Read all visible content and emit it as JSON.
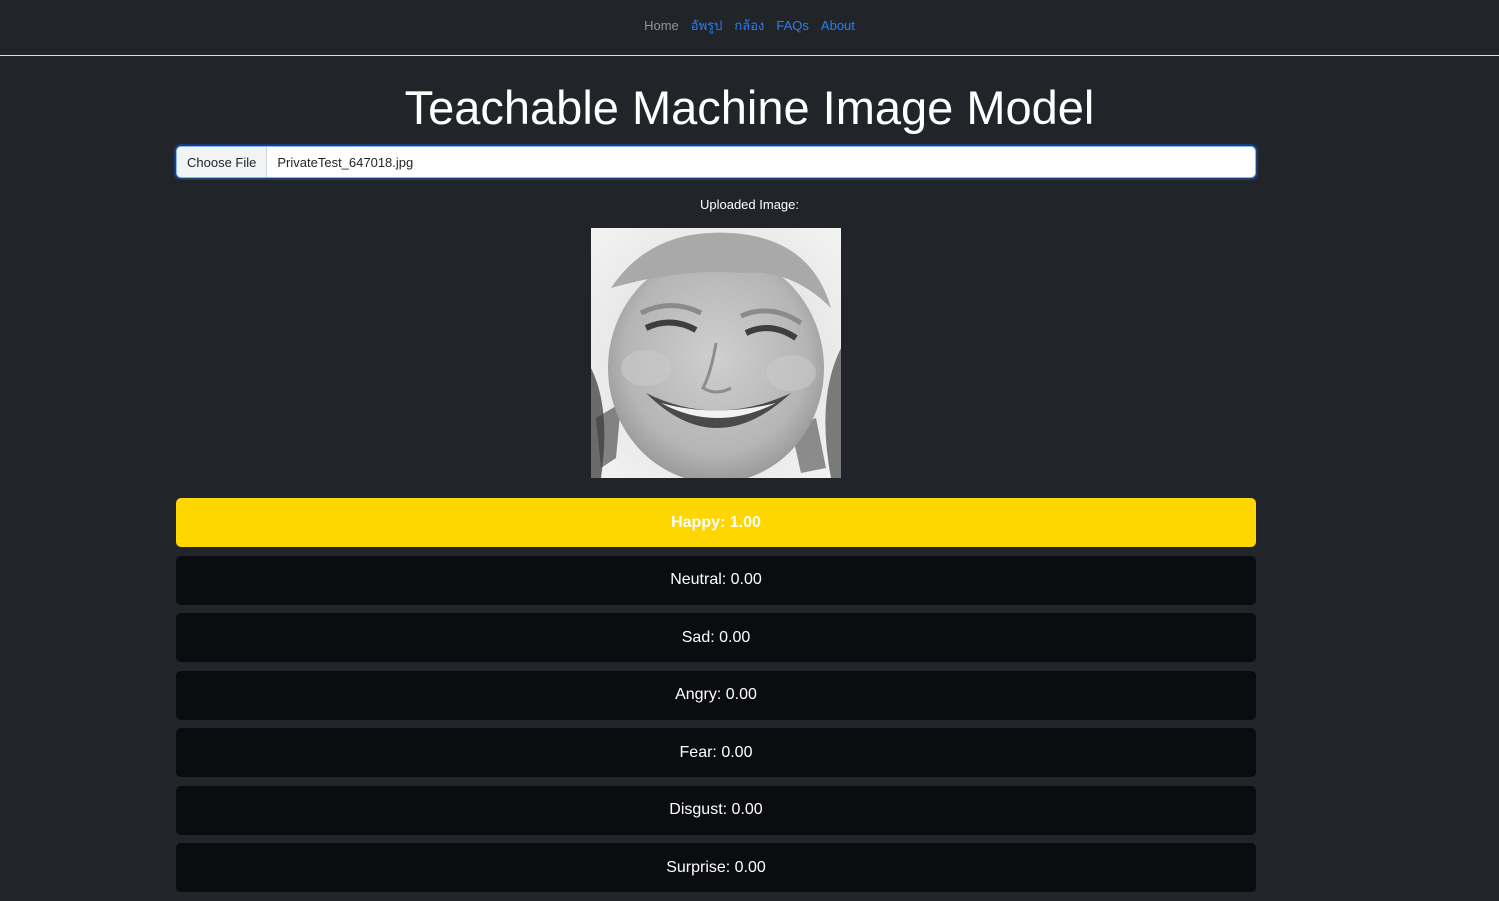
{
  "nav": {
    "items": [
      {
        "label": "Home",
        "style": "muted"
      },
      {
        "label": "อัพรูป",
        "style": "link"
      },
      {
        "label": "กล้อง",
        "style": "link"
      },
      {
        "label": "FAQs",
        "style": "link"
      },
      {
        "label": "About",
        "style": "link"
      }
    ]
  },
  "page": {
    "title": "Teachable Machine Image Model"
  },
  "file_input": {
    "button_label": "Choose File",
    "file_name": "PrivateTest_647018.jpg"
  },
  "preview": {
    "label": "Uploaded Image:",
    "image_icon": "face-photo"
  },
  "results": [
    {
      "label": "Happy: 1.00",
      "highlight": true
    },
    {
      "label": "Neutral: 0.00",
      "highlight": false
    },
    {
      "label": "Sad: 0.00",
      "highlight": false
    },
    {
      "label": "Angry: 0.00",
      "highlight": false
    },
    {
      "label": "Fear: 0.00",
      "highlight": false
    },
    {
      "label": "Disgust: 0.00",
      "highlight": false
    },
    {
      "label": "Surprise: 0.00",
      "highlight": false
    }
  ],
  "colors": {
    "background": "#212529",
    "highlight": "#ffd600",
    "row": "#0b0c0f",
    "link": "#2d7bf0"
  }
}
